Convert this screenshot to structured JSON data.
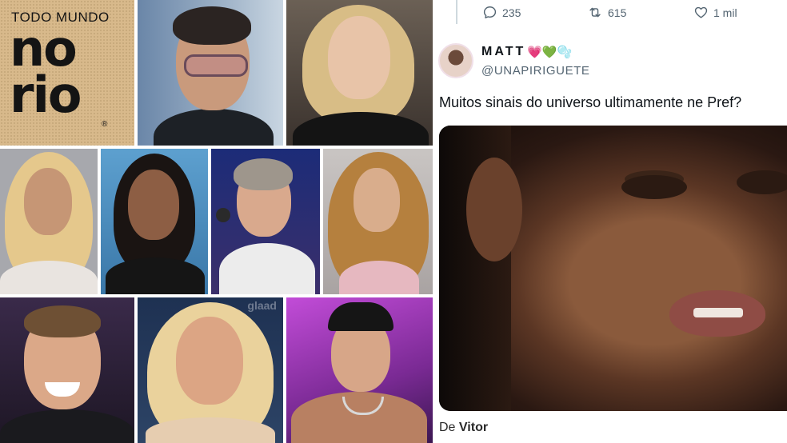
{
  "collage": {
    "logo": {
      "top_text": "TODO MUNDO",
      "line1": "no",
      "line2": "rio",
      "registered": "®"
    },
    "portraits": [
      {
        "id": "portrait-1"
      },
      {
        "id": "portrait-2"
      },
      {
        "id": "portrait-3"
      },
      {
        "id": "portrait-4"
      },
      {
        "id": "portrait-5"
      },
      {
        "id": "portrait-6"
      },
      {
        "id": "portrait-7"
      },
      {
        "id": "portrait-8"
      },
      {
        "id": "portrait-9"
      }
    ],
    "bg_text": "glaad"
  },
  "tweet": {
    "actions": {
      "replies": "235",
      "reposts": "615",
      "likes": "1 mil"
    },
    "author": {
      "name": "MATT",
      "emojis": "💗💚🫧",
      "handle": "@UNAPIRIGUETE"
    },
    "text": "Muitos sinais do universo ultimamente ne Pref?",
    "colors": {
      "text": "#0f1419",
      "secondary": "#536471",
      "divider": "#cfd9de"
    }
  },
  "credit": {
    "prefix": "De",
    "name": "Vitor"
  }
}
